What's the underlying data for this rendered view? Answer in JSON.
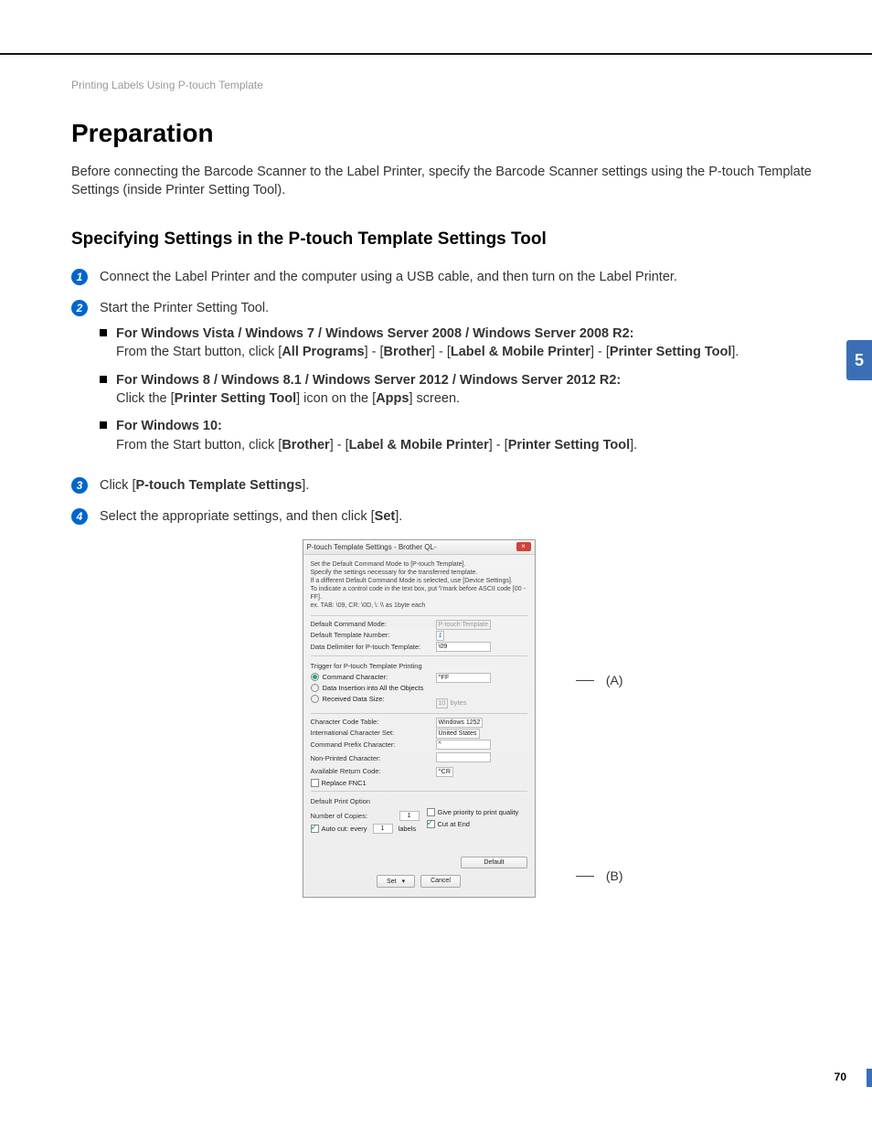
{
  "breadcrumb": "Printing Labels Using P-touch Template",
  "page_title": "Preparation",
  "intro": "Before connecting the Barcode Scanner to the Label Printer, specify the Barcode Scanner settings using the P-touch Template Settings (inside Printer Setting Tool).",
  "section_title": "Specifying Settings in the P-touch Template Settings Tool",
  "side_tab": "5",
  "page_number": "70",
  "steps": {
    "s1": {
      "num": "1",
      "text": "Connect the Label Printer and the computer using a USB cable, and then turn on the Label Printer."
    },
    "s2": {
      "num": "2",
      "text": "Start the Printer Setting Tool.",
      "sub1_head": "For Windows Vista / Windows 7 / Windows Server 2008 / Windows Server 2008 R2:",
      "sub1_body_a": "From the Start button, click [",
      "sub1_b1": "All Programs",
      "sub1_body_b": "] - [",
      "sub1_b2": "Brother",
      "sub1_body_c": "] - [",
      "sub1_b3": "Label & Mobile Printer",
      "sub1_body_d": "] - [",
      "sub1_b4": "Printer Setting Tool",
      "sub1_body_e": "].",
      "sub2_head": "For Windows 8 / Windows 8.1 / Windows Server 2012 / Windows Server 2012 R2:",
      "sub2_body_a": "Click the [",
      "sub2_b1": "Printer Setting Tool",
      "sub2_body_b": "] icon on the [",
      "sub2_b2": "Apps",
      "sub2_body_c": "] screen.",
      "sub3_head": "For Windows 10:",
      "sub3_body_a": "From the Start button, click [",
      "sub3_b1": "Brother",
      "sub3_body_b": "] - [",
      "sub3_b2": "Label & Mobile Printer",
      "sub3_body_c": "] - [",
      "sub3_b3": "Printer Setting Tool",
      "sub3_body_d": "]."
    },
    "s3": {
      "num": "3",
      "text_a": "Click [",
      "b1": "P-touch Template Settings",
      "text_b": "]."
    },
    "s4": {
      "num": "4",
      "text_a": "Select the appropriate settings, and then click [",
      "b1": "Set",
      "text_b": "]."
    }
  },
  "label_a": "(A)",
  "label_b": "(B)",
  "dialog": {
    "title": "P-touch Template Settings - Brother QL-",
    "help_text": "Set the Default Command Mode to [P-touch Template].\nSpecify the settings necessary for the transferred template.\nIf a different Default Command Mode is selected, use [Device Settings].\nTo indicate a control code in the text box, put '\\'mark before ASCII code [00 -FF].\n   ex. TAB: \\09,  CR: \\0D,  \\: \\\\  as 1byte each",
    "default_command_mode_lbl": "Default Command Mode:",
    "default_command_mode_val": "P-touch Template",
    "default_template_number_lbl": "Default Template Number:",
    "default_template_number_val": "1",
    "data_delimiter_lbl": "Data Delimiter for P-touch Template:",
    "data_delimiter_val": "\\09",
    "trigger_lbl": "Trigger for P-touch Template Printing",
    "r1_lbl": "Command Character:",
    "r1_val": "^FF",
    "r2_lbl": "Data Insertion into All the Objects",
    "r3_lbl": "Received Data Size:",
    "r3_val": "10",
    "r3_unit": "bytes",
    "char_code_lbl": "Character Code Table:",
    "char_code_val": "Windows 1252",
    "intl_lbl": "International Character Set:",
    "intl_val": "United States",
    "prefix_lbl": "Command Prefix Character:",
    "prefix_val": "^",
    "nonprinted_lbl": "Non-Printed Character:",
    "nonprinted_val": "",
    "avail_ret_lbl": "Available Return Code:",
    "avail_ret_val": "^CR",
    "replace_fnc1_lbl": "Replace FNC1",
    "default_print_lbl": "Default Print Option",
    "copies_lbl": "Number of Copies:",
    "copies_val": "1",
    "priority_lbl": "Give priority to print quality",
    "autocut_lbl": "Auto cut:   every",
    "autocut_val": "1",
    "autocut_unit": "labels",
    "cutend_lbl": "Cut at End",
    "btn_default": "Default",
    "btn_set": "Set",
    "btn_cancel": "Cancel"
  }
}
